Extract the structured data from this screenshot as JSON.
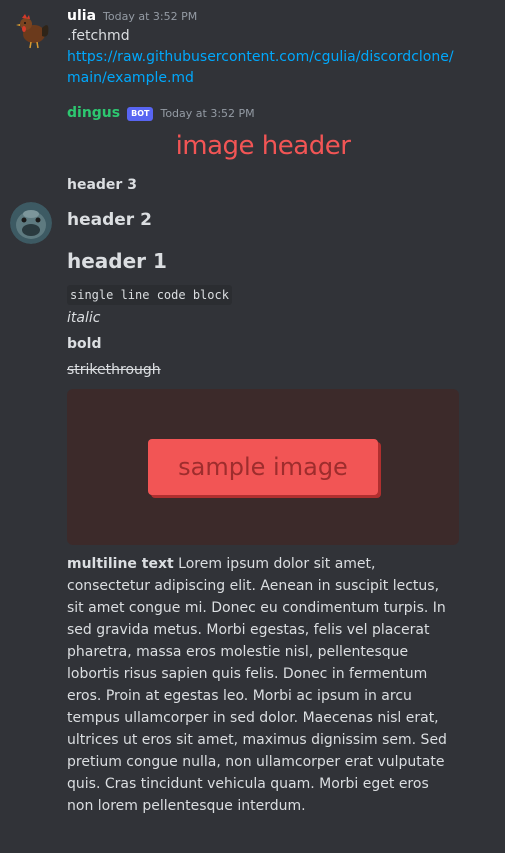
{
  "colors": {
    "background": "#313338",
    "text": "#dbdee1",
    "muted": "#949ba4",
    "link": "#00a8fc",
    "bot_name": "#2dc770",
    "bot_badge": "#5865f2",
    "accent_red": "#f25555",
    "image_bg": "#3c2a2a",
    "button_text": "#9e2d2d"
  },
  "messages": [
    {
      "avatar_icon": "rooster-avatar-icon",
      "username": "ulia",
      "timestamp": "Today at 3:52 PM",
      "command": ".fetchmd",
      "link": "https://raw.githubusercontent.com/cgulia/discordclone/main/example.md"
    },
    {
      "avatar_icon": "fish-avatar-icon",
      "username": "dingus",
      "badge": "BOT",
      "timestamp": "Today at 3:52 PM",
      "image_header": "image header",
      "header3": "header 3",
      "header2": "header 2",
      "header1": "header 1",
      "code": "single line code block",
      "italic": "italic",
      "bold": "bold",
      "strikethrough": "strikethrough",
      "image_label": "sample image",
      "multiline_label": "multiline text",
      "multiline_body": " Lorem ipsum dolor sit amet, consectetur adipiscing elit. Aenean in suscipit lectus, sit amet congue mi. Donec eu condimentum turpis. In sed gravida metus. Morbi egestas, felis vel placerat pharetra, massa eros molestie nisl, pellentesque lobortis risus sapien quis felis. Donec in fermentum eros. Proin at egestas leo. Morbi ac ipsum in arcu tempus ullamcorper in sed dolor. Maecenas nisl erat, ultrices ut eros sit amet, maximus dignissim sem. Sed pretium congue nulla, non ullamcorper erat vulputate quis. Cras tincidunt vehicula quam. Morbi eget eros non lorem pellentesque interdum."
    }
  ]
}
